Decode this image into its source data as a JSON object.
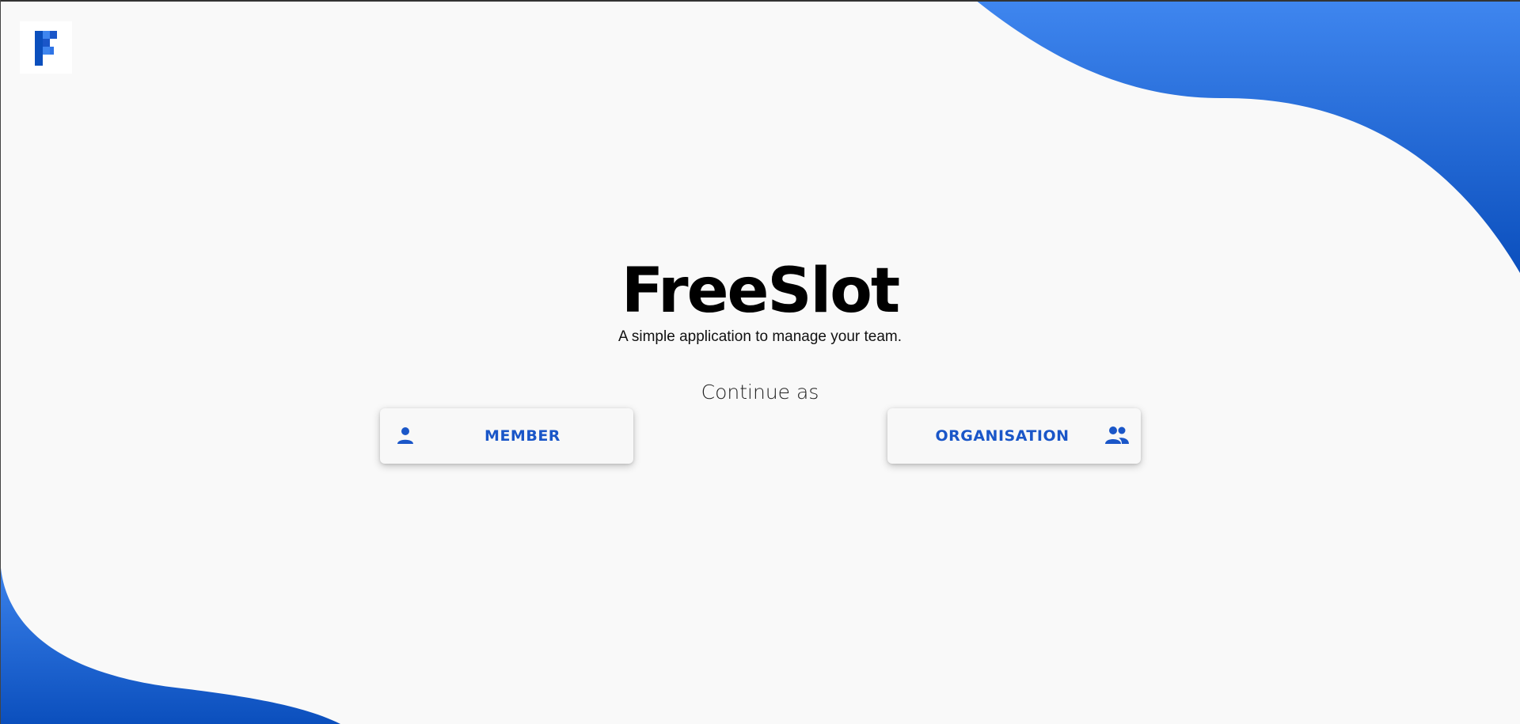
{
  "app": {
    "title": "FreeSlot",
    "subtitle": "A simple application to manage your team."
  },
  "logo": {
    "icon": "freeslot-logo-icon",
    "letter": "F"
  },
  "continue_prompt": "Continue as",
  "buttons": {
    "member": {
      "label": "MEMBER",
      "icon": "person-icon"
    },
    "organisation": {
      "label": "ORGANISATION",
      "icon": "group-icon"
    }
  },
  "colors": {
    "accent": "#1a56c8",
    "wave_light": "#3f86ef",
    "wave_dark": "#0b4fbd",
    "background": "#f9f9f9"
  }
}
